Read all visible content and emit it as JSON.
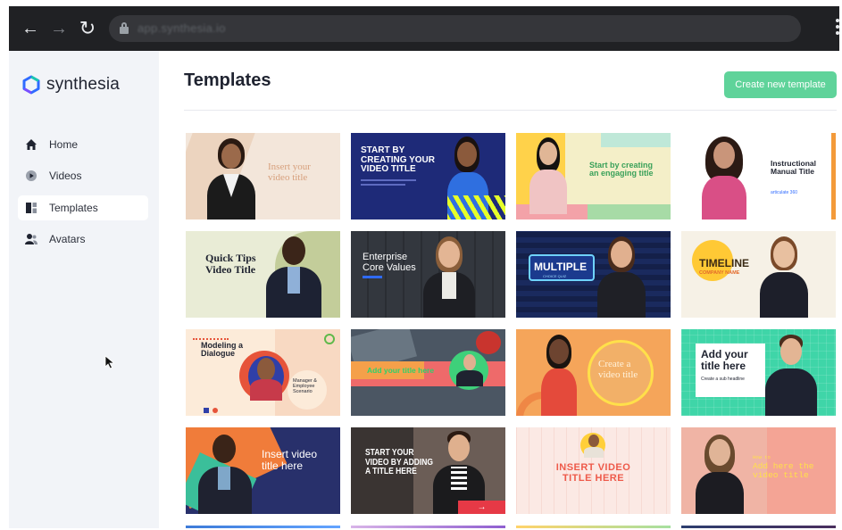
{
  "browser": {
    "url": "app.synthesia.io",
    "back_icon": "←",
    "forward_icon": "→",
    "reload_icon": "↻"
  },
  "sidebar": {
    "logo_text": "synthesia",
    "items": [
      {
        "label": "Home",
        "icon": "home-icon",
        "active": false
      },
      {
        "label": "Videos",
        "icon": "play-icon",
        "active": false
      },
      {
        "label": "Templates",
        "icon": "templates-icon",
        "active": true
      },
      {
        "label": "Avatars",
        "icon": "avatars-icon",
        "active": false
      }
    ]
  },
  "main": {
    "title": "Templates",
    "create_button": "Create new template",
    "accent_color": "#5fd39a"
  },
  "templates": [
    {
      "title": "Insert your\nvideo title"
    },
    {
      "title": "START BY\nCREATING YOUR\nVIDEO TITLE"
    },
    {
      "title": "Start by creating\nan engaging title"
    },
    {
      "title": "Instructional\nManual Title",
      "brand": "articulate 360"
    },
    {
      "title": "Quick Tips\nVideo Title"
    },
    {
      "title": "Enterprise\nCore Values"
    },
    {
      "title": "MULTIPLE",
      "subtitle": "CHOICE QUIZ"
    },
    {
      "title": "TIMELINE",
      "subtitle": "COMPANY NAME"
    },
    {
      "title": "Modeling a\nDialogue",
      "subtitle": "Manager &\nEmployee\nScenario"
    },
    {
      "title": "Add your title here"
    },
    {
      "title": "Create a\nvideo title"
    },
    {
      "title": "Add your\ntitle here",
      "subtitle": "Create a sub headline"
    },
    {
      "title": "Insert video\ntitle here"
    },
    {
      "title": "START YOUR\nVIDEO BY ADDING\nA TITLE HERE"
    },
    {
      "title": "INSERT VIDEO\nTITLE HERE"
    },
    {
      "title": "Add here the\nvideo title",
      "subtitle": "How to"
    }
  ]
}
